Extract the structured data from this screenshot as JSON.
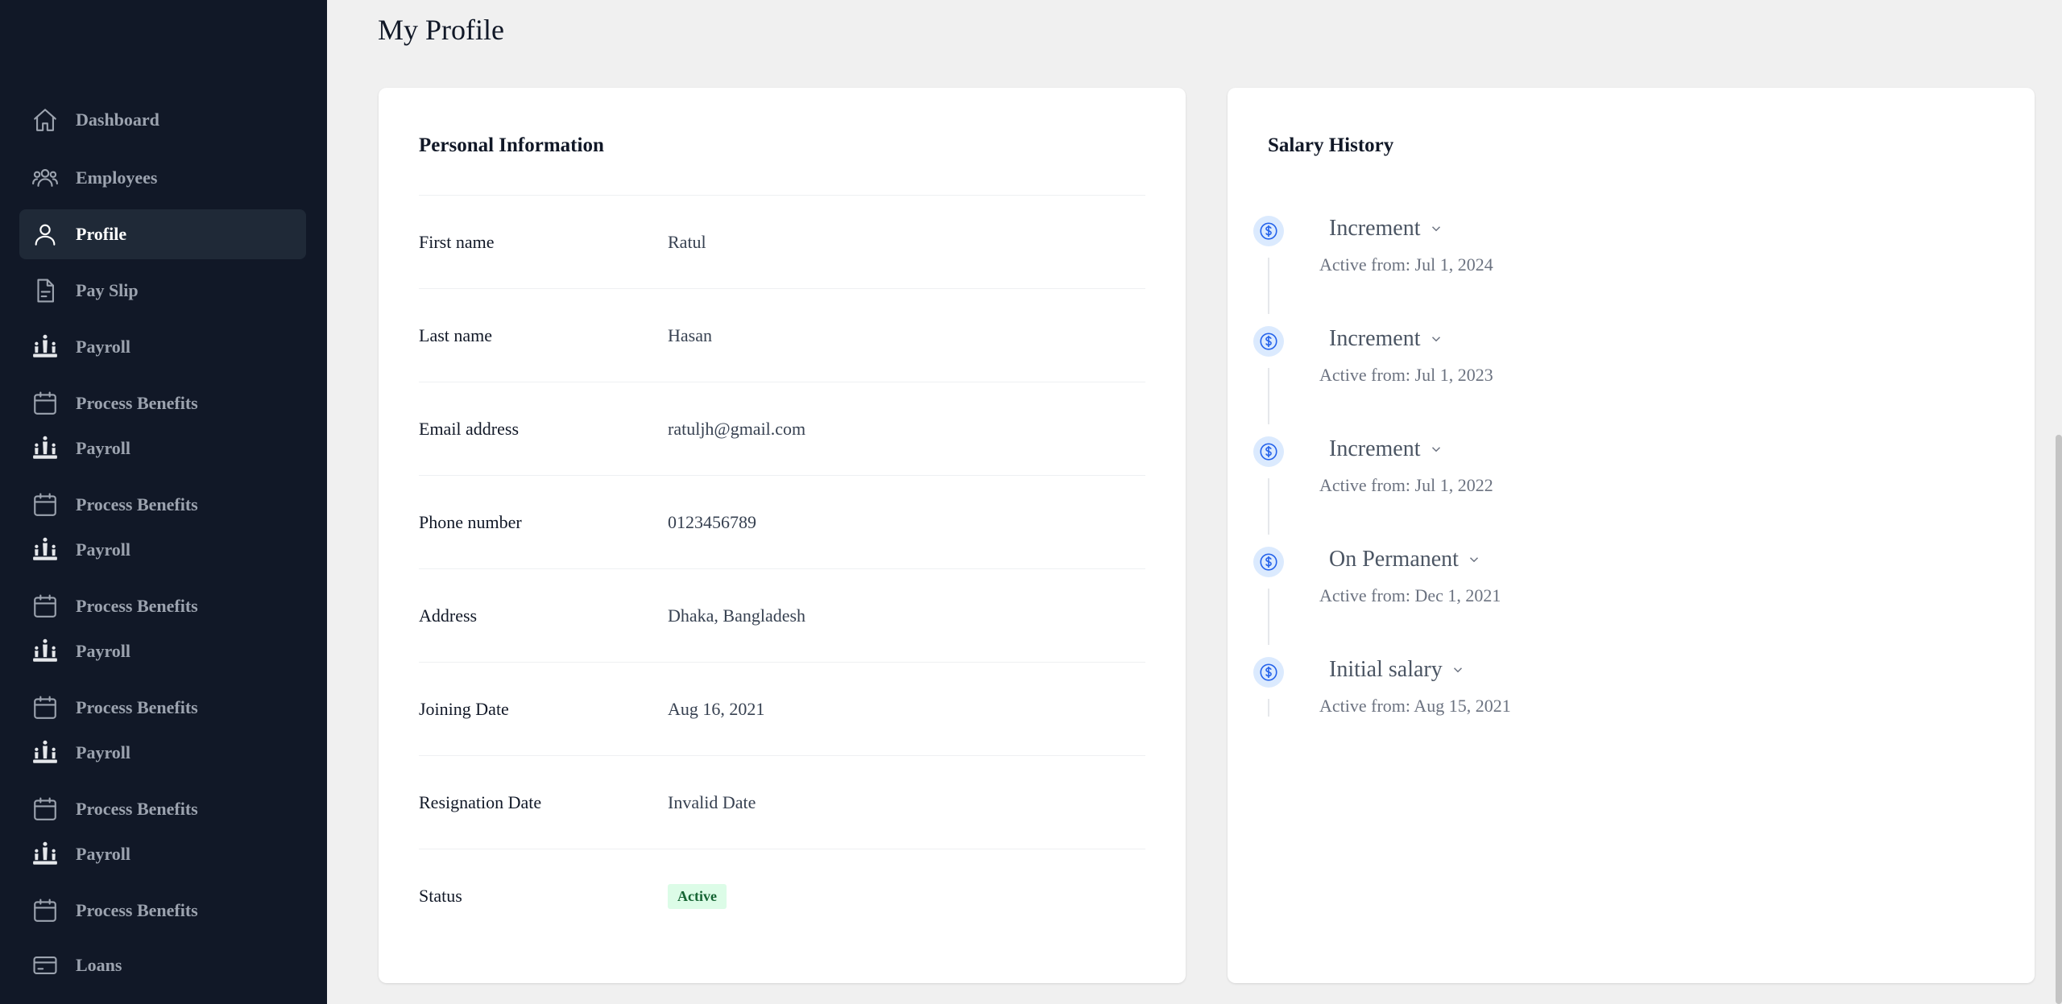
{
  "sidebar": {
    "items": [
      {
        "label": "Dashboard",
        "icon": "home-icon"
      },
      {
        "label": "Employees",
        "icon": "users-icon"
      },
      {
        "label": "Profile",
        "icon": "user-icon",
        "active": true
      },
      {
        "label": "Pay Slip",
        "icon": "document-icon"
      },
      {
        "label": "Payroll",
        "icon": "chess-icon"
      },
      {
        "label": "Process Benefits",
        "icon": "calendar-icon"
      },
      {
        "label": "Payroll",
        "icon": "chess-icon"
      },
      {
        "label": "Process Benefits",
        "icon": "calendar-icon"
      },
      {
        "label": "Payroll",
        "icon": "chess-icon"
      },
      {
        "label": "Process Benefits",
        "icon": "calendar-icon"
      },
      {
        "label": "Payroll",
        "icon": "chess-icon"
      },
      {
        "label": "Process Benefits",
        "icon": "calendar-icon"
      },
      {
        "label": "Payroll",
        "icon": "chess-icon"
      },
      {
        "label": "Process Benefits",
        "icon": "calendar-icon"
      },
      {
        "label": "Payroll",
        "icon": "chess-icon"
      },
      {
        "label": "Process Benefits",
        "icon": "calendar-icon"
      },
      {
        "label": "Loans",
        "icon": "credit-card-icon"
      }
    ]
  },
  "page": {
    "title": "My Profile"
  },
  "personal_info": {
    "title": "Personal Information",
    "rows": [
      {
        "label": "First name",
        "value": "Ratul"
      },
      {
        "label": "Last name",
        "value": "Hasan"
      },
      {
        "label": "Email address",
        "value": "ratuljh@gmail.com"
      },
      {
        "label": "Phone number",
        "value": "0123456789"
      },
      {
        "label": "Address",
        "value": "Dhaka, Bangladesh"
      },
      {
        "label": "Joining Date",
        "value": "Aug 16, 2021"
      },
      {
        "label": "Resignation Date",
        "value": "Invalid Date"
      },
      {
        "label": "Status",
        "value": "Active"
      }
    ]
  },
  "salary_history": {
    "title": "Salary History",
    "items": [
      {
        "type": "Increment",
        "date": "Active from: Jul 1, 2024"
      },
      {
        "type": "Increment",
        "date": "Active from: Jul 1, 2023"
      },
      {
        "type": "Increment",
        "date": "Active from: Jul 1, 2022"
      },
      {
        "type": "On Permanent",
        "date": "Active from: Dec 1, 2021"
      },
      {
        "type": "Initial salary",
        "date": "Active from: Aug 15, 2021"
      }
    ]
  },
  "colors": {
    "sidebar_bg": "#111827",
    "active_item_bg": "#1f2937",
    "status_active_bg": "#dcfce7",
    "status_active_text": "#166534",
    "accent": "#2563eb"
  }
}
